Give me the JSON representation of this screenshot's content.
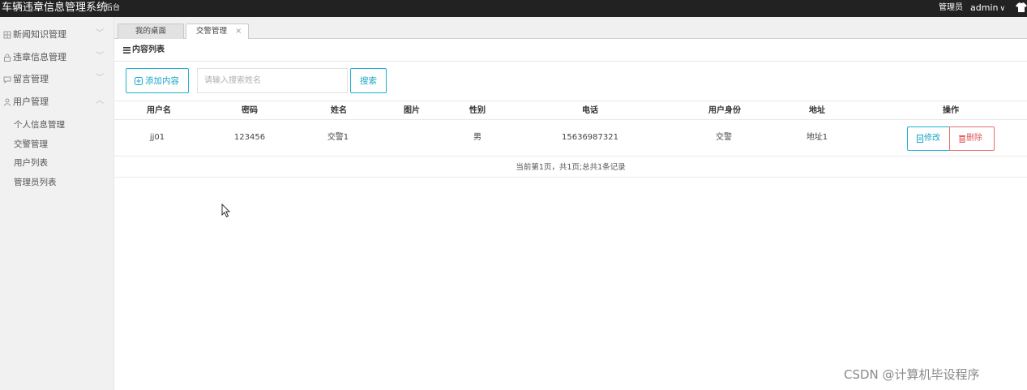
{
  "header": {
    "app_title": "车辆违章信息管理系统",
    "app_sub": "后台",
    "role_label": "管理员",
    "username": "admin",
    "user_caret": "∨"
  },
  "sidebar": {
    "groups": [
      {
        "label": "新闻知识管理",
        "icon": "grid-icon",
        "chevron": "﹀"
      },
      {
        "label": "违章信息管理",
        "icon": "lock-icon",
        "chevron": "﹀"
      },
      {
        "label": "留言管理",
        "icon": "chat-icon",
        "chevron": "﹀"
      },
      {
        "label": "用户管理",
        "icon": "user-icon",
        "chevron": "︿"
      }
    ],
    "sub_items": [
      "个人信息管理",
      "交警管理",
      "用户列表",
      "管理员列表"
    ]
  },
  "tabs": {
    "home": "我的桌面",
    "active": "交警管理",
    "close": "×"
  },
  "content": {
    "title": "内容列表",
    "add_button": "添加内容",
    "search_placeholder": "请输入搜索姓名",
    "search_button": "搜索"
  },
  "table": {
    "headers": [
      "用户名",
      "密码",
      "姓名",
      "图片",
      "性别",
      "电话",
      "用户身份",
      "地址",
      "操作"
    ],
    "rows": [
      {
        "username": "jj01",
        "password": "123456",
        "name": "交警1",
        "image": "",
        "gender": "男",
        "phone": "15636987321",
        "identity": "交警",
        "address": "地址1"
      }
    ],
    "edit_label": "修改",
    "delete_label": "删除",
    "pager": "当前第1页，共1页;总共1条记录"
  },
  "watermark": "CSDN @计算机毕设程序",
  "colors": {
    "topbar": "#222222",
    "accent": "#1ab1d4",
    "danger": "#e86d6d",
    "sidebar_bg": "#f1f1f1"
  }
}
